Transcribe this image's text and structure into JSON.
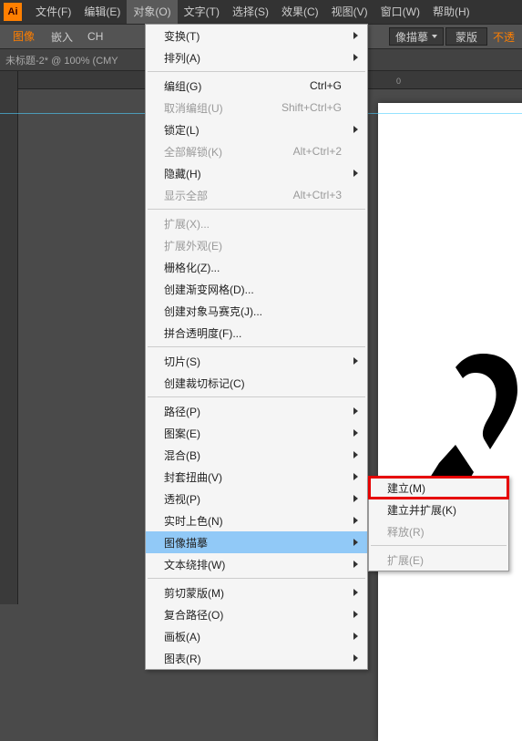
{
  "app": {
    "logo": "Ai"
  },
  "menubar": [
    {
      "label": "文件(F)",
      "active": false
    },
    {
      "label": "编辑(E)",
      "active": false
    },
    {
      "label": "对象(O)",
      "active": true
    },
    {
      "label": "文字(T)",
      "active": false
    },
    {
      "label": "选择(S)",
      "active": false
    },
    {
      "label": "效果(C)",
      "active": false
    },
    {
      "label": "视图(V)",
      "active": false
    },
    {
      "label": "窗口(W)",
      "active": false
    },
    {
      "label": "帮助(H)",
      "active": false
    }
  ],
  "toolbar": {
    "image_label": "图像",
    "embed_label": "嵌入",
    "ch_label": "CH",
    "trace_label": "像描摹",
    "mask_label": "蒙版",
    "opacity_label": "不透"
  },
  "doc_tab": "未标题-2* @ 100% (CMY",
  "ruler_h_ticks": [
    "0"
  ],
  "object_menu": [
    {
      "t": "item",
      "label": "变换(T)",
      "arrow": true
    },
    {
      "t": "item",
      "label": "排列(A)",
      "arrow": true
    },
    {
      "t": "sep"
    },
    {
      "t": "item",
      "label": "编组(G)",
      "shortcut": "Ctrl+G"
    },
    {
      "t": "item",
      "label": "取消编组(U)",
      "shortcut": "Shift+Ctrl+G",
      "disabled": true
    },
    {
      "t": "item",
      "label": "锁定(L)",
      "arrow": true
    },
    {
      "t": "item",
      "label": "全部解锁(K)",
      "shortcut": "Alt+Ctrl+2",
      "disabled": true
    },
    {
      "t": "item",
      "label": "隐藏(H)",
      "arrow": true
    },
    {
      "t": "item",
      "label": "显示全部",
      "shortcut": "Alt+Ctrl+3",
      "disabled": true
    },
    {
      "t": "sep"
    },
    {
      "t": "item",
      "label": "扩展(X)...",
      "disabled": true
    },
    {
      "t": "item",
      "label": "扩展外观(E)",
      "disabled": true
    },
    {
      "t": "item",
      "label": "栅格化(Z)..."
    },
    {
      "t": "item",
      "label": "创建渐变网格(D)..."
    },
    {
      "t": "item",
      "label": "创建对象马赛克(J)..."
    },
    {
      "t": "item",
      "label": "拼合透明度(F)..."
    },
    {
      "t": "sep"
    },
    {
      "t": "item",
      "label": "切片(S)",
      "arrow": true
    },
    {
      "t": "item",
      "label": "创建裁切标记(C)"
    },
    {
      "t": "sep"
    },
    {
      "t": "item",
      "label": "路径(P)",
      "arrow": true
    },
    {
      "t": "item",
      "label": "图案(E)",
      "arrow": true
    },
    {
      "t": "item",
      "label": "混合(B)",
      "arrow": true
    },
    {
      "t": "item",
      "label": "封套扭曲(V)",
      "arrow": true
    },
    {
      "t": "item",
      "label": "透视(P)",
      "arrow": true
    },
    {
      "t": "item",
      "label": "实时上色(N)",
      "arrow": true
    },
    {
      "t": "item",
      "label": "图像描摹",
      "arrow": true,
      "highlight": true
    },
    {
      "t": "item",
      "label": "文本绕排(W)",
      "arrow": true
    },
    {
      "t": "sep"
    },
    {
      "t": "item",
      "label": "剪切蒙版(M)",
      "arrow": true
    },
    {
      "t": "item",
      "label": "复合路径(O)",
      "arrow": true
    },
    {
      "t": "item",
      "label": "画板(A)",
      "arrow": true
    },
    {
      "t": "item",
      "label": "图表(R)",
      "arrow": true
    }
  ],
  "trace_submenu": [
    {
      "t": "item",
      "label": "建立(M)",
      "boxed": true
    },
    {
      "t": "item",
      "label": "建立并扩展(K)"
    },
    {
      "t": "item",
      "label": "释放(R)",
      "disabled": true
    },
    {
      "t": "sep"
    },
    {
      "t": "item",
      "label": "扩展(E)",
      "disabled": true
    }
  ]
}
